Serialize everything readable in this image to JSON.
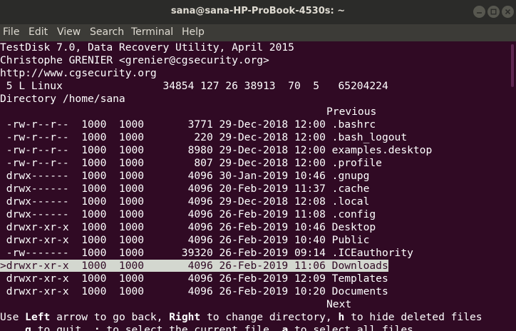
{
  "window": {
    "title": "sana@sana-HP-ProBook-4530s: ~"
  },
  "menu": {
    "items": [
      "File",
      "Edit",
      "View",
      "Search",
      "Terminal",
      "Help"
    ]
  },
  "terminal": {
    "header": [
      "TestDisk 7.0, Data Recovery Utility, April 2015",
      "Christophe GRENIER <grenier@cgsecurity.org>",
      "http://www.cgsecurity.org",
      " 5 L Linux                34854 127 26 38913  70  5   65204224",
      "Directory /home/sana"
    ],
    "previous_label": "Previous",
    "next_label": "Next",
    "rows": [
      {
        "perm": " -rw-r--r--",
        "uid": "1000",
        "gid": "1000",
        "size": "3771",
        "date": "29-Dec-2018",
        "time": "12:00",
        "name": ".bashrc"
      },
      {
        "perm": " -rw-r--r--",
        "uid": "1000",
        "gid": "1000",
        "size": "220",
        "date": "29-Dec-2018",
        "time": "12:00",
        "name": ".bash_logout"
      },
      {
        "perm": " -rw-r--r--",
        "uid": "1000",
        "gid": "1000",
        "size": "8980",
        "date": "29-Dec-2018",
        "time": "12:00",
        "name": "examples.desktop"
      },
      {
        "perm": " -rw-r--r--",
        "uid": "1000",
        "gid": "1000",
        "size": "807",
        "date": "29-Dec-2018",
        "time": "12:00",
        "name": ".profile"
      },
      {
        "perm": " drwx------",
        "uid": "1000",
        "gid": "1000",
        "size": "4096",
        "date": "30-Jan-2019",
        "time": "10:46",
        "name": ".gnupg"
      },
      {
        "perm": " drwx------",
        "uid": "1000",
        "gid": "1000",
        "size": "4096",
        "date": "20-Feb-2019",
        "time": "11:37",
        "name": ".cache"
      },
      {
        "perm": " drwx------",
        "uid": "1000",
        "gid": "1000",
        "size": "4096",
        "date": "29-Dec-2018",
        "time": "12:08",
        "name": ".local"
      },
      {
        "perm": " drwx------",
        "uid": "1000",
        "gid": "1000",
        "size": "4096",
        "date": "26-Feb-2019",
        "time": "11:08",
        "name": ".config"
      },
      {
        "perm": " drwxr-xr-x",
        "uid": "1000",
        "gid": "1000",
        "size": "4096",
        "date": "26-Feb-2019",
        "time": "10:46",
        "name": "Desktop"
      },
      {
        "perm": " drwxr-xr-x",
        "uid": "1000",
        "gid": "1000",
        "size": "4096",
        "date": "26-Feb-2019",
        "time": "10:40",
        "name": "Public"
      },
      {
        "perm": " -rw-------",
        "uid": "1000",
        "gid": "1000",
        "size": "39320",
        "date": "26-Feb-2019",
        "time": "09:14",
        "name": ".ICEauthority"
      },
      {
        "perm": ">drwxr-xr-x",
        "uid": "1000",
        "gid": "1000",
        "size": "4096",
        "date": "26-Feb-2019",
        "time": "11:06",
        "name": "Downloads",
        "selected": true
      },
      {
        "perm": " drwxr-xr-x",
        "uid": "1000",
        "gid": "1000",
        "size": "4096",
        "date": "26-Feb-2019",
        "time": "12:09",
        "name": "Templates"
      },
      {
        "perm": " drwxr-xr-x",
        "uid": "1000",
        "gid": "1000",
        "size": "4096",
        "date": "26-Feb-2019",
        "time": "10:20",
        "name": "Documents"
      }
    ],
    "help1": [
      {
        "text": "Use ",
        "bold": false
      },
      {
        "text": "Left",
        "bold": true
      },
      {
        "text": " arrow to go back, ",
        "bold": false
      },
      {
        "text": "Right",
        "bold": true
      },
      {
        "text": " to change directory, ",
        "bold": false
      },
      {
        "text": "h",
        "bold": true
      },
      {
        "text": " to hide deleted files",
        "bold": false
      }
    ],
    "help2": [
      {
        "text": "    ",
        "bold": false
      },
      {
        "text": "q",
        "bold": true
      },
      {
        "text": " to quit, ",
        "bold": false
      },
      {
        "text": ":",
        "bold": true
      },
      {
        "text": " to select the current file, ",
        "bold": false
      },
      {
        "text": "a",
        "bold": true
      },
      {
        "text": " to select all files",
        "bold": false
      }
    ]
  },
  "colors": {
    "terminal_bg": "#300a24",
    "terminal_fg": "#ffffff",
    "selection_bg": "#d3d7cf",
    "titlebar_bg": "#2b2b29",
    "menubar_bg": "#3c3b37"
  }
}
